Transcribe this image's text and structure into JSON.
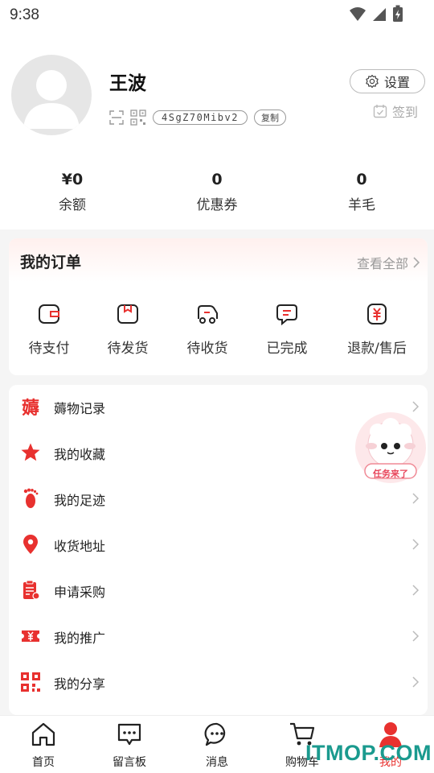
{
  "status_bar": {
    "time": "9:38"
  },
  "profile": {
    "username": "王波",
    "id_code": "4SgZ70Mibv2",
    "copy_label": "复制",
    "settings_label": "设置",
    "signin_label": "签到"
  },
  "stats": [
    {
      "value": "¥0",
      "label": "余额"
    },
    {
      "value": "0",
      "label": "优惠券"
    },
    {
      "value": "0",
      "label": "羊毛"
    }
  ],
  "orders": {
    "title": "我的订单",
    "view_all": "查看全部",
    "items": [
      {
        "label": "待支付",
        "icon": "wallet-icon"
      },
      {
        "label": "待发货",
        "icon": "package-icon"
      },
      {
        "label": "待收货",
        "icon": "truck-icon"
      },
      {
        "label": "已完成",
        "icon": "message-check-icon"
      },
      {
        "label": "退款/售后",
        "icon": "yen-refund-icon"
      }
    ]
  },
  "menu": [
    {
      "label": "薅物记录",
      "icon": "hao-icon"
    },
    {
      "label": "我的收藏",
      "icon": "star-icon"
    },
    {
      "label": "我的足迹",
      "icon": "footprint-icon"
    },
    {
      "label": "收货地址",
      "icon": "location-icon"
    },
    {
      "label": "申请采购",
      "icon": "clipboard-icon"
    },
    {
      "label": "我的推广",
      "icon": "ticket-icon"
    },
    {
      "label": "我的分享",
      "icon": "qrcode-icon"
    }
  ],
  "mascot": {
    "label": "任务来了"
  },
  "tabbar": [
    {
      "label": "首页",
      "icon": "home-icon"
    },
    {
      "label": "留言板",
      "icon": "message-board-icon"
    },
    {
      "label": "消息",
      "icon": "chat-icon"
    },
    {
      "label": "购物车",
      "icon": "cart-icon"
    },
    {
      "label": "我的",
      "icon": "user-icon",
      "active": true
    }
  ],
  "watermark": "ITMOP.COM",
  "colors": {
    "accent": "#e8312f",
    "text": "#222222",
    "muted": "#999999",
    "watermark": "#1a9a8e"
  }
}
